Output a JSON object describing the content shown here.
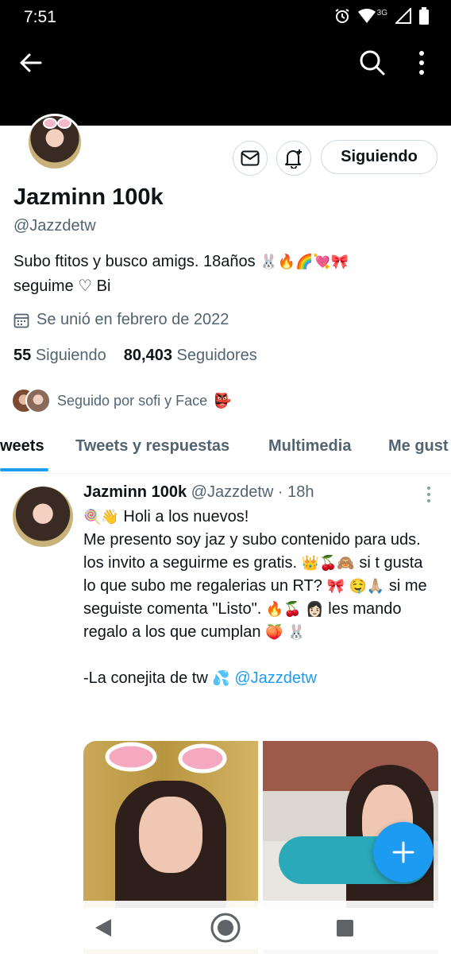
{
  "status_bar": {
    "time": "7:51",
    "network": "3G",
    "icons": [
      "alarm-icon",
      "wifi-icon",
      "signal-icon",
      "battery-icon"
    ]
  },
  "app_bar": {
    "icons": [
      "back-arrow-icon",
      "search-icon",
      "more-vertical-icon"
    ]
  },
  "profile": {
    "display_name": "Jazminn 100k",
    "handle": "@Jazzdetw",
    "bio_line1": "Subo ftitos y busco amigs. 18años",
    "bio_line1_emojis": "🐰🔥🌈💘🎀",
    "bio_line2": "seguime ♡ Bi",
    "joined": "Se unió en febrero de 2022",
    "following_count": "55",
    "following_label": "Siguiendo",
    "followers_count": "80,403",
    "followers_label": "Seguidores",
    "followed_by": "Seguido por sofi y Face",
    "followed_by_emoji": "👺",
    "follow_button_label": "Siguiendo"
  },
  "tabs": [
    {
      "label": "weets",
      "active": true
    },
    {
      "label": "Tweets y respuestas",
      "active": false
    },
    {
      "label": "Multimedia",
      "active": false
    },
    {
      "label": "Me gust",
      "active": false
    }
  ],
  "tweet": {
    "author_name": "Jazminn 100k",
    "author_handle": "@Jazzdetw",
    "separator": "·",
    "time": "18h",
    "line1_emojis": "🍭👋",
    "line1": "Holi a los nuevos!",
    "line2": "Me presento soy jaz y subo contenido para uds.",
    "line3_a": "los invito a seguirme es gratis.",
    "line3_emojis": "👑🍒🙈",
    "line3_b": "si t gusta lo que subo me regalerias un RT?",
    "line3_emoji_end": "🎀",
    "line4_emojis": "🤤🙏🏼",
    "line4": "si me seguiste comenta \"Listo\".",
    "line4_emoji_end": "🔥🍒",
    "line5_emoji": "👩🏻",
    "line5": "les mando regalo a los que cumplan",
    "line5_emoji_end": "🍑",
    "line6_emoji": "🐰",
    "signature": "-La conejita de tw",
    "signature_emoji": "💦",
    "signature_mention": "@Jazzdetw"
  },
  "colors": {
    "accent": "#1d9bf0",
    "text_primary": "#0f1419",
    "text_secondary": "#536471",
    "border": "#cfd9de"
  }
}
